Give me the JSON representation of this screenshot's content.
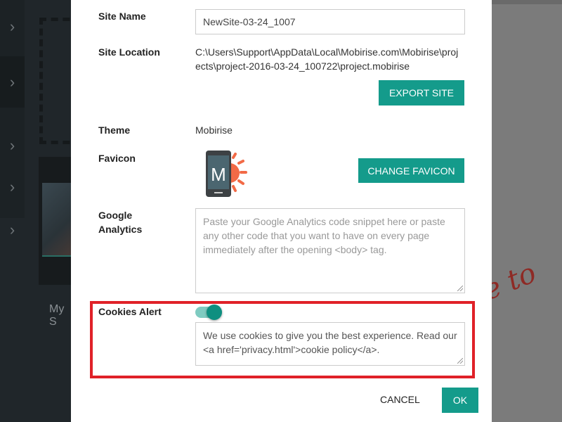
{
  "background": {
    "sidebar_items": 5,
    "card_label": "My S",
    "scribble": "e to"
  },
  "form": {
    "site_name": {
      "label": "Site Name",
      "value": "NewSite-03-24_1007"
    },
    "site_location": {
      "label": "Site Location",
      "value_line1": "C:\\Users\\Support\\AppData\\Local\\Mobirise.com\\Mobirise\\proj",
      "value_line2": "ects\\project-2016-03-24_100722\\project.mobirise",
      "export_button": "EXPORT SITE"
    },
    "theme": {
      "label": "Theme",
      "value": "Mobirise"
    },
    "favicon": {
      "label": "Favicon",
      "icon_letter": "M",
      "change_button": "CHANGE FAVICON"
    },
    "google_analytics": {
      "label_line1": "Google",
      "label_line2": "Analytics",
      "placeholder": "Paste your Google Analytics code snippet here or paste any other code that you want to have on every page immediately after the opening <body> tag."
    },
    "cookies_alert": {
      "label": "Cookies Alert",
      "enabled": true,
      "value": "We use cookies to give you the best experience. Read our <a href='privacy.html'>cookie policy</a>."
    }
  },
  "footer": {
    "cancel": "CANCEL",
    "ok": "OK"
  },
  "colors": {
    "accent": "#149b8b",
    "highlight": "#e02128"
  }
}
